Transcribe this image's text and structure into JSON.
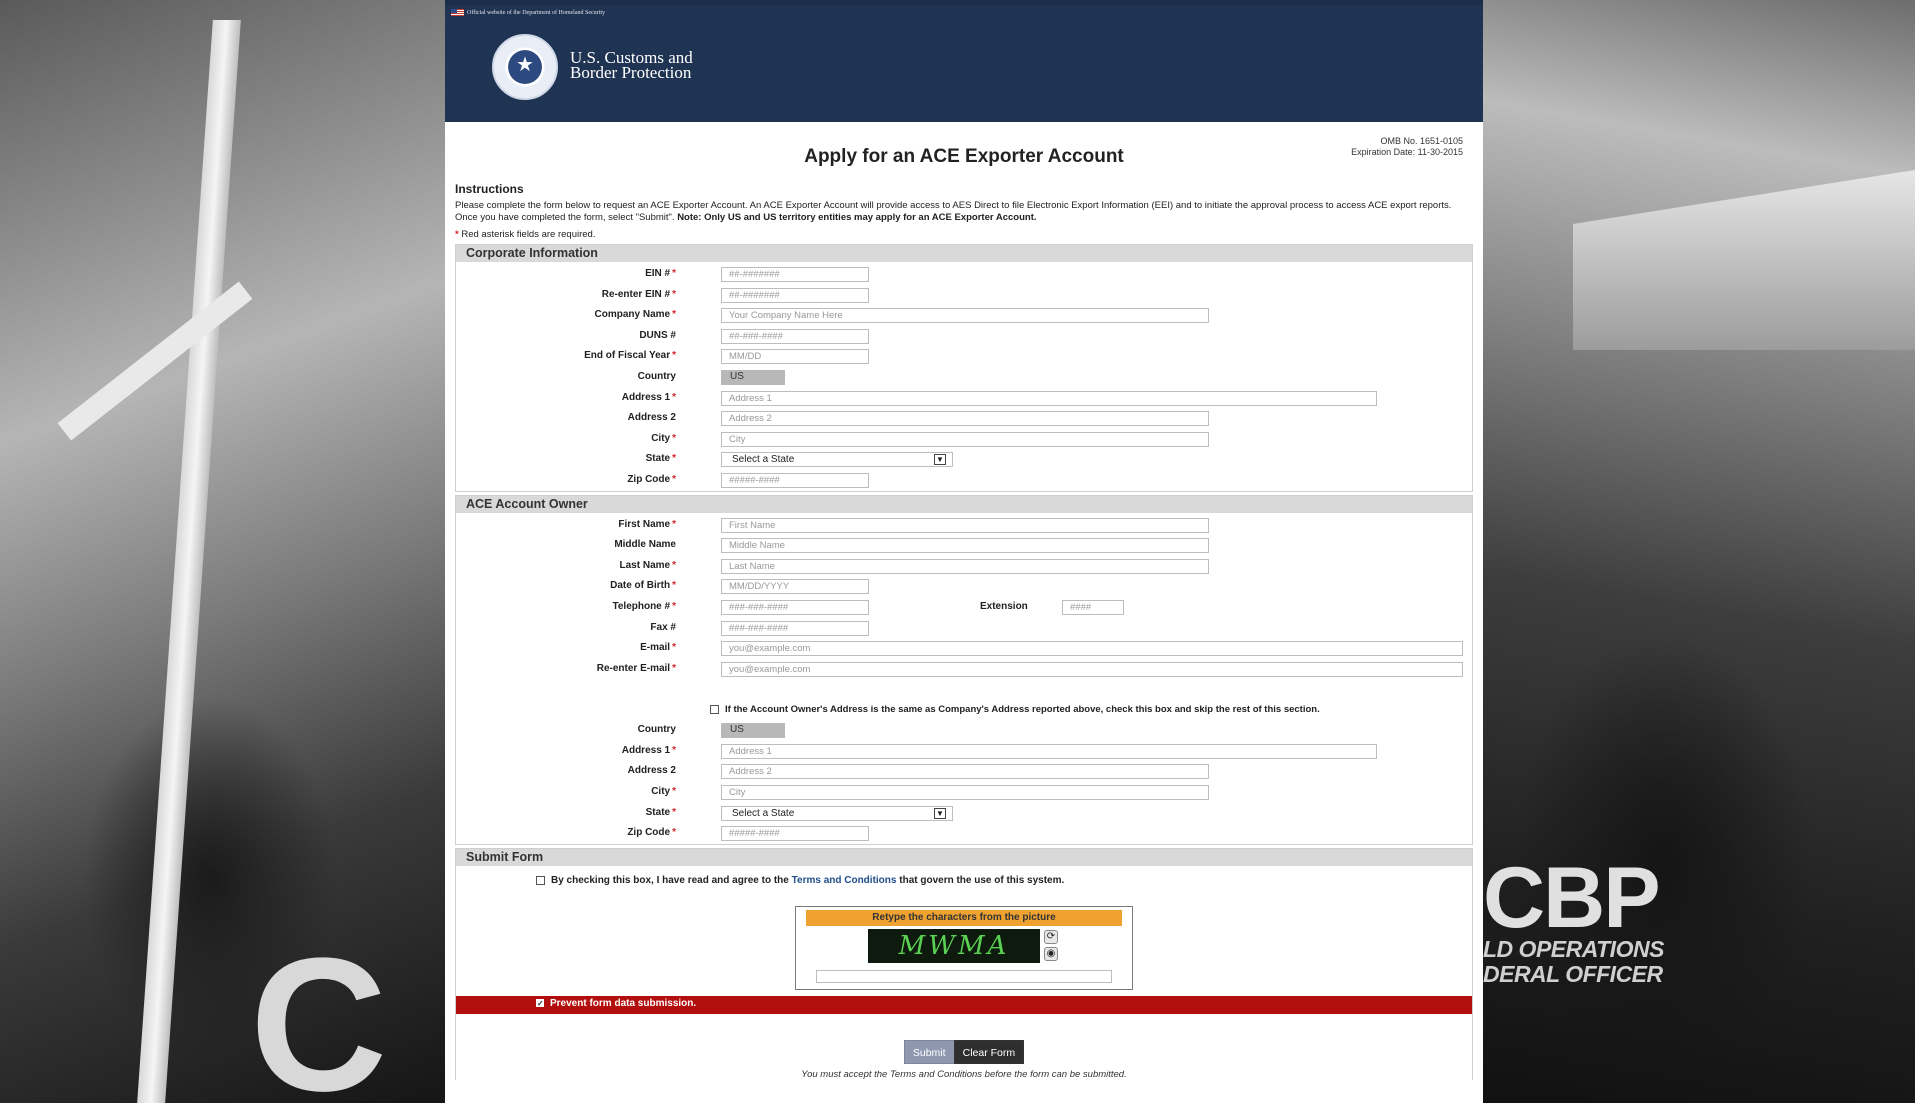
{
  "header": {
    "official_text": "Official website of the Department of Homeland Security",
    "agency_line1": "U.S. Customs and",
    "agency_line2": "Border Protection"
  },
  "omb": {
    "number": "OMB No. 1651-0105",
    "expiration": "Expiration Date: 11-30-2015"
  },
  "page_title": "Apply for an ACE Exporter Account",
  "instructions": {
    "title": "Instructions",
    "text": "Please complete the form below to request an ACE Exporter Account. An ACE Exporter Account will provide access to AES Direct to file Electronic Export Information (EEI) and to initiate the approval process to access ACE export reports. Once you have completed the form, select \"Submit\".",
    "note": "Note: Only US and US territory entities may apply for an ACE Exporter Account.",
    "required_note": "Red asterisk fields are required."
  },
  "corporate": {
    "heading": "Corporate Information",
    "ein": {
      "label": "EIN #",
      "placeholder": "##-#######"
    },
    "ein_confirm": {
      "label": "Re-enter EIN #",
      "placeholder": "##-#######"
    },
    "company": {
      "label": "Company Name",
      "placeholder": "Your Company Name Here"
    },
    "duns": {
      "label": "DUNS #",
      "placeholder": "##-###-####"
    },
    "fiscal": {
      "label": "End of Fiscal Year",
      "placeholder": "MM/DD"
    },
    "country": {
      "label": "Country",
      "value": "US"
    },
    "address1": {
      "label": "Address 1",
      "placeholder": "Address 1"
    },
    "address2": {
      "label": "Address 2",
      "placeholder": "Address 2"
    },
    "city": {
      "label": "City",
      "placeholder": "City"
    },
    "state": {
      "label": "State",
      "value": "Select a State"
    },
    "zip": {
      "label": "Zip Code",
      "placeholder": "#####-####"
    }
  },
  "owner": {
    "heading": "ACE Account Owner",
    "first": {
      "label": "First Name",
      "placeholder": "First Name"
    },
    "middle": {
      "label": "Middle Name",
      "placeholder": "Middle Name"
    },
    "last": {
      "label": "Last Name",
      "placeholder": "Last Name"
    },
    "dob": {
      "label": "Date of Birth",
      "placeholder": "MM/DD/YYYY"
    },
    "phone": {
      "label": "Telephone #",
      "placeholder": "###-###-####"
    },
    "extension": {
      "label": "Extension",
      "placeholder": "####"
    },
    "fax": {
      "label": "Fax #",
      "placeholder": "###-###-####"
    },
    "email": {
      "label": "E-mail",
      "placeholder": "you@example.com"
    },
    "email_confirm": {
      "label": "Re-enter E-mail",
      "placeholder": "you@example.com"
    },
    "same_address_text": "If the Account Owner's Address is the same as Company's Address reported above, check this box and skip the rest of this section.",
    "country": {
      "label": "Country",
      "value": "US"
    },
    "address1": {
      "label": "Address 1",
      "placeholder": "Address 1"
    },
    "address2": {
      "label": "Address 2",
      "placeholder": "Address 2"
    },
    "city": {
      "label": "City",
      "placeholder": "City"
    },
    "state": {
      "label": "State",
      "value": "Select a State"
    },
    "zip": {
      "label": "Zip Code",
      "placeholder": "#####-####"
    }
  },
  "submit": {
    "heading": "Submit Form",
    "terms_prefix": "By checking this box, I have read and agree to the",
    "terms_link": "Terms and Conditions",
    "terms_suffix": "that govern the use of this system.",
    "captcha_title": "Retype the characters from the picture",
    "captcha_image_text": "MWMA",
    "prevent_text": "Prevent form data submission.",
    "submit_label": "Submit",
    "clear_label": "Clear Form",
    "note": "You must accept the Terms and Conditions before the form can be submitted."
  },
  "background": {
    "cbp_text": "CBP",
    "cbp_sub1": "LD OPERATIONS",
    "cbp_sub2": "DERAL OFFICER",
    "left_letter": "C"
  }
}
